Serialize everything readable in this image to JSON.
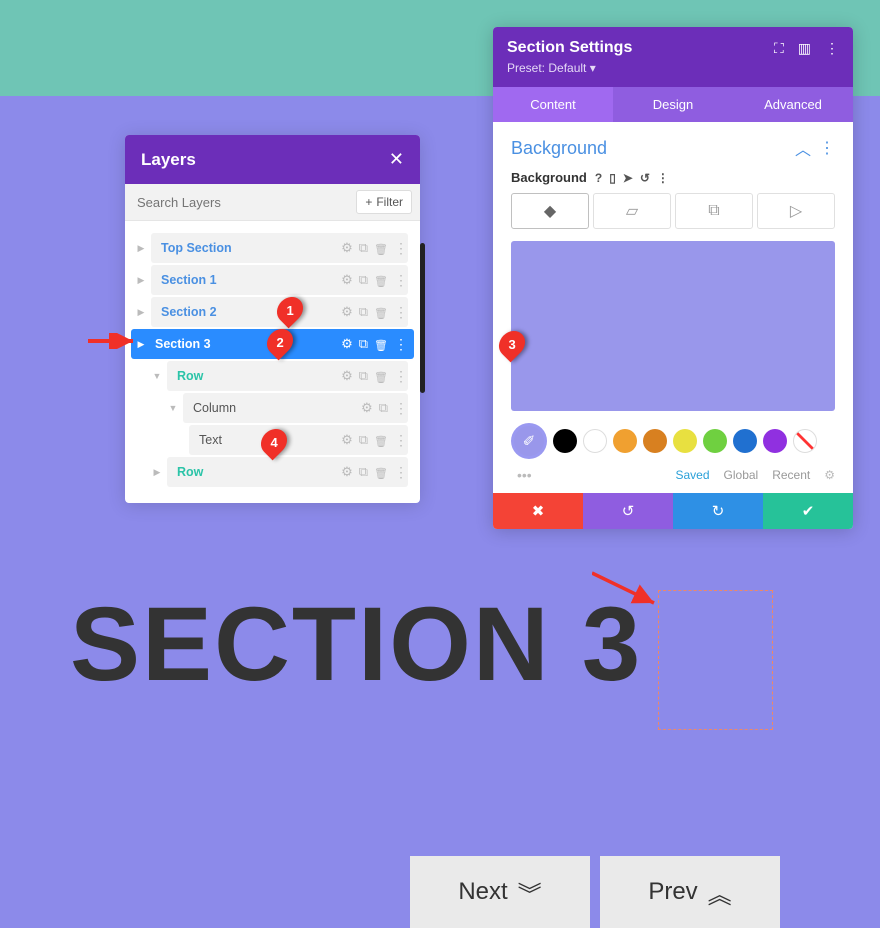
{
  "layers": {
    "title": "Layers",
    "search_placeholder": "Search Layers",
    "filter_label": "Filter",
    "items": [
      {
        "label": "Top Section",
        "kind": "blue"
      },
      {
        "label": "Section 1",
        "kind": "blue"
      },
      {
        "label": "Section 2",
        "kind": "blue"
      },
      {
        "label": "Section 3",
        "kind": "selected"
      },
      {
        "label": "Row",
        "kind": "teal",
        "indent": 1
      },
      {
        "label": "Column",
        "kind": "plain",
        "indent": 2
      },
      {
        "label": "Text",
        "kind": "plain",
        "indent": 3
      },
      {
        "label": "Row",
        "kind": "teal",
        "indent": 1
      }
    ]
  },
  "settings": {
    "title": "Section Settings",
    "preset": "Preset: Default ▾",
    "tabs": [
      "Content",
      "Design",
      "Advanced"
    ],
    "active_tab": 0,
    "section_heading": "Background",
    "bg_label": "Background",
    "palette": {
      "saved": "Saved",
      "global": "Global",
      "recent": "Recent"
    },
    "swatch_colors": [
      "#000000",
      "#ffffff",
      "#f0a030",
      "#d88020",
      "#e8e040",
      "#6fd040",
      "#2070d0",
      "#9030e0"
    ],
    "preview_color": "#9997eb"
  },
  "heading_text": "SECTION 3",
  "callouts": {
    "c1": "1",
    "c2": "2",
    "c3": "3",
    "c4": "4"
  },
  "nav": {
    "next": "Next",
    "prev": "Prev"
  }
}
